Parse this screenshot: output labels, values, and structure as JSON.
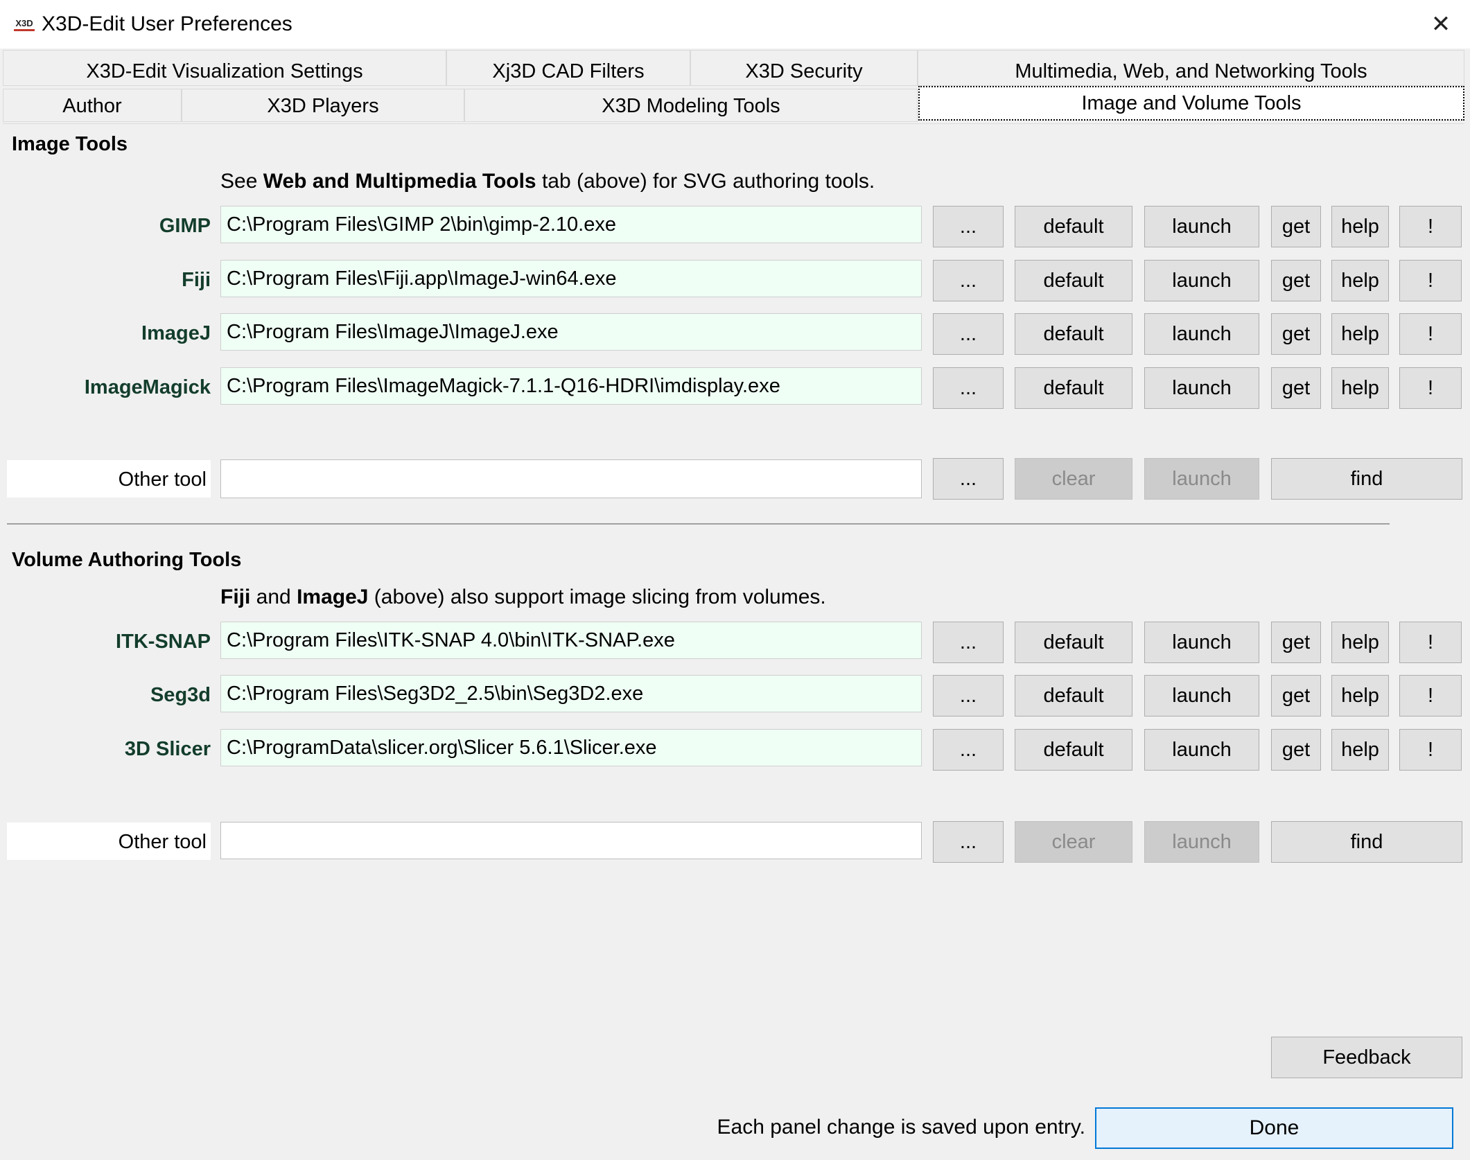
{
  "window": {
    "icon_text": "X3D",
    "title": "X3D-Edit User Preferences",
    "close_glyph": "✕"
  },
  "tabs": {
    "row1": [
      "X3D-Edit Visualization Settings",
      "Xj3D CAD Filters",
      "X3D Security",
      "Multimedia, Web, and Networking Tools"
    ],
    "row2": [
      "Author",
      "X3D Players",
      "X3D Modeling Tools",
      "Image and Volume Tools"
    ],
    "selected": "Image and Volume Tools"
  },
  "image_tools": {
    "title": "Image Tools",
    "note_prefix": "See ",
    "note_bold": "Web and Multipmedia Tools",
    "note_suffix": " tab (above) for SVG authoring tools.",
    "tools": [
      {
        "label": "GIMP",
        "path": "C:\\Program Files\\GIMP 2\\bin\\gimp-2.10.exe"
      },
      {
        "label": "Fiji",
        "path": "C:\\Program Files\\Fiji.app\\ImageJ-win64.exe"
      },
      {
        "label": "ImageJ",
        "path": "C:\\Program Files\\ImageJ\\ImageJ.exe"
      },
      {
        "label": "ImageMagick",
        "path": "C:\\Program Files\\ImageMagick-7.1.1-Q16-HDRI\\imdisplay.exe"
      }
    ],
    "other": {
      "label": "Other tool",
      "path": ""
    }
  },
  "volume_tools": {
    "title": "Volume Authoring Tools",
    "note_bold1": "Fiji",
    "note_mid": " and ",
    "note_bold2": "ImageJ",
    "note_suffix": " (above) also support image slicing from volumes.",
    "tools": [
      {
        "label": "ITK-SNAP",
        "path": "C:\\Program Files\\ITK-SNAP 4.0\\bin\\ITK-SNAP.exe"
      },
      {
        "label": "Seg3d",
        "path": "C:\\Program Files\\Seg3D2_2.5\\bin\\Seg3D2.exe"
      },
      {
        "label": "3D Slicer",
        "path": "C:\\ProgramData\\slicer.org\\Slicer 5.6.1\\Slicer.exe"
      }
    ],
    "other": {
      "label": "Other tool",
      "path": ""
    }
  },
  "buttons": {
    "browse": "...",
    "default": "default",
    "launch": "launch",
    "get": "get",
    "help": "help",
    "bang": "!",
    "clear": "clear",
    "find": "find",
    "feedback": "Feedback",
    "done": "Done"
  },
  "footer": {
    "status": "Each panel change is saved upon entry."
  }
}
